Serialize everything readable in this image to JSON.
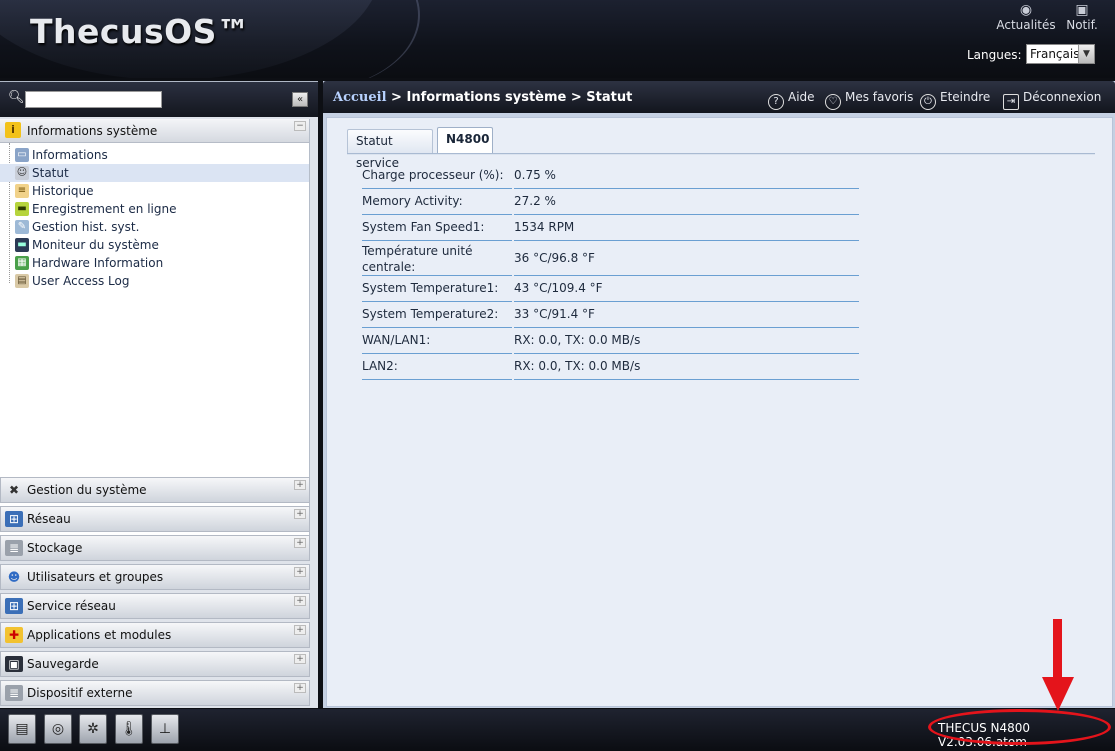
{
  "header": {
    "logo": "ThecusOS™",
    "news_label": "Actualités",
    "notif_label": "Notif.",
    "language_label": "Langues:",
    "language_value": "Français"
  },
  "sidebar": {
    "search_placeholder": "",
    "collapse_symbol": "«",
    "info_panel_title": "Informations système",
    "info_items": [
      {
        "label": "Informations",
        "icon": "monitor-icon"
      },
      {
        "label": "Statut",
        "icon": "person-icon"
      },
      {
        "label": "Historique",
        "icon": "clipboard-icon"
      },
      {
        "label": "Enregistrement en ligne",
        "icon": "register-icon"
      },
      {
        "label": "Gestion hist. syst.",
        "icon": "log-icon"
      },
      {
        "label": "Moniteur du système",
        "icon": "monitor2-icon"
      },
      {
        "label": "Hardware Information",
        "icon": "hardware-icon"
      },
      {
        "label": "User Access Log",
        "icon": "access-log-icon"
      }
    ],
    "panels": [
      {
        "label": "Gestion du système",
        "icon": "tools-icon"
      },
      {
        "label": "Réseau",
        "icon": "network-icon"
      },
      {
        "label": "Stockage",
        "icon": "storage-icon"
      },
      {
        "label": "Utilisateurs et groupes",
        "icon": "users-icon"
      },
      {
        "label": "Service réseau",
        "icon": "service-icon"
      },
      {
        "label": "Applications et modules",
        "icon": "apps-icon"
      },
      {
        "label": "Sauvegarde",
        "icon": "backup-icon"
      },
      {
        "label": "Dispositif externe",
        "icon": "external-icon"
      }
    ]
  },
  "main": {
    "breadcrumb_home": "Accueil",
    "breadcrumb_rest": " > Informations système > Statut",
    "tool_help": "Aide",
    "tool_favorites": "Mes favoris",
    "tool_shutdown": "Eteindre",
    "tool_logout": "Déconnexion",
    "tabs": [
      "Statut service",
      "N4800"
    ],
    "rows": [
      {
        "label": "Charge processeur (%):",
        "value": "0.75 %"
      },
      {
        "label": "Memory Activity:",
        "value": "27.2 %"
      },
      {
        "label": "System Fan Speed1:",
        "value": "1534 RPM"
      },
      {
        "label": "Température unité centrale:",
        "value": "36 °C/96.8 °F"
      },
      {
        "label": "System Temperature1:",
        "value": "43 °C/109.4 °F"
      },
      {
        "label": "System Temperature2:",
        "value": "33 °C/91.4 °F"
      },
      {
        "label": "WAN/LAN1:",
        "value": "RX: 0.0, TX: 0.0 MB/s"
      },
      {
        "label": "LAN2:",
        "value": "RX: 0.0, TX: 0.0 MB/s"
      }
    ]
  },
  "footer": {
    "version": "THECUS N4800 V2.03.06.atom",
    "annotation_color": "#e4141b"
  }
}
